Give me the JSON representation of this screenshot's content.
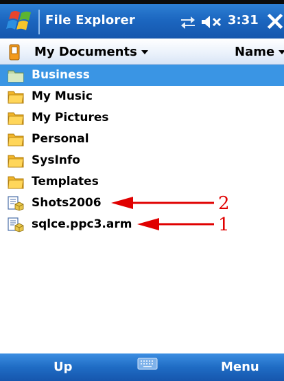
{
  "titlebar": {
    "app_title": "File Explorer",
    "time": "3:31",
    "icons": [
      "windows-start-icon",
      "connectivity-icon",
      "speaker-muted-icon",
      "close-icon"
    ]
  },
  "header": {
    "folder": "My Documents",
    "sort": "Name"
  },
  "items": [
    {
      "label": "Business",
      "type": "folder",
      "selected": true
    },
    {
      "label": "My Music",
      "type": "folder",
      "selected": false
    },
    {
      "label": "My Pictures",
      "type": "folder",
      "selected": false
    },
    {
      "label": "Personal",
      "type": "folder",
      "selected": false
    },
    {
      "label": "SysInfo",
      "type": "folder",
      "selected": false
    },
    {
      "label": "Templates",
      "type": "folder",
      "selected": false
    },
    {
      "label": "Shots2006",
      "type": "installer",
      "selected": false
    },
    {
      "label": "sqlce.ppc3.arm",
      "type": "installer",
      "selected": false
    }
  ],
  "annotations": [
    {
      "number": "2",
      "target": "Shots2006"
    },
    {
      "number": "1",
      "target": "sqlce.ppc3.arm"
    }
  ],
  "bottombar": {
    "left_softkey": "Up",
    "right_softkey": "Menu"
  },
  "colors": {
    "titlebar": "#1c67c0",
    "selection": "#3a95e4",
    "folder": "#f6c83c",
    "annotation": "#e00000"
  }
}
